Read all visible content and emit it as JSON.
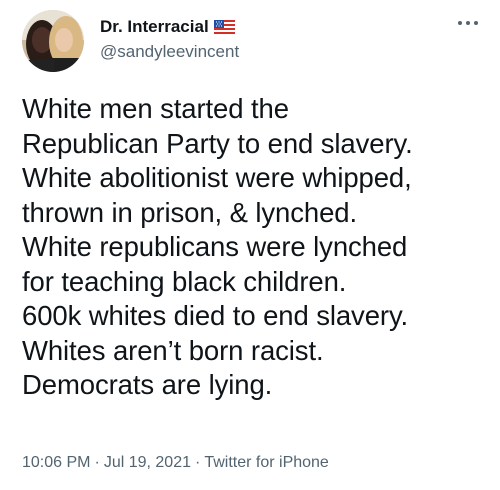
{
  "user": {
    "display_name": "Dr. Interracial",
    "handle": "@sandyleevincent",
    "avatar_icon": "avatar-photo",
    "flag_icon": "us-flag-icon",
    "more_icon": "more-options-icon"
  },
  "tweet": {
    "lines": [
      "White men started the",
      "Republican Party to end slavery.",
      "White abolitionist were whipped,",
      "thrown in prison, & lynched.",
      "White republicans were lynched",
      "for teaching black children.",
      "600k whites died to end slavery.",
      "Whites aren’t born racist.",
      "Democrats are lying."
    ]
  },
  "meta": {
    "time": "10:06 PM",
    "separator": "·",
    "date": "Jul 19, 2021",
    "source": "Twitter for iPhone"
  },
  "colors": {
    "text": "#0f1419",
    "secondary": "#536471"
  }
}
